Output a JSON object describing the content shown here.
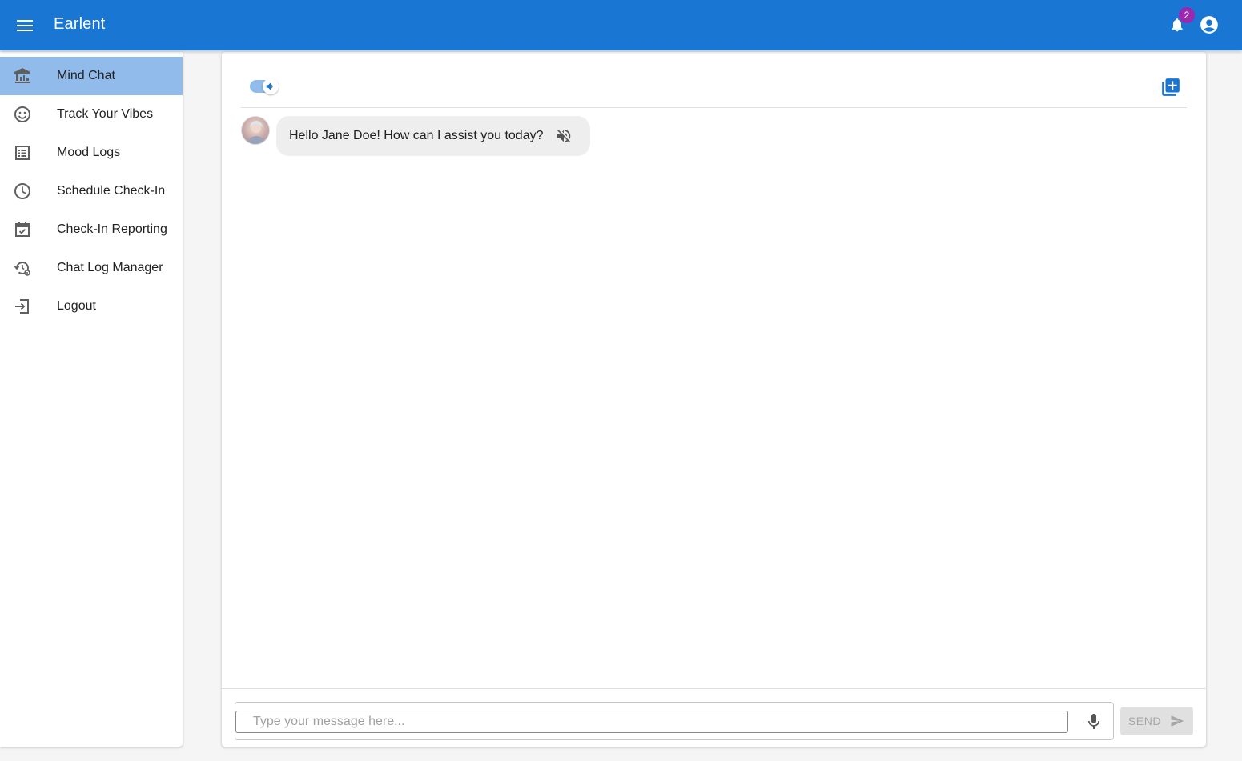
{
  "app": {
    "title": "Earlent",
    "notifications_count": "2",
    "brand_color": "#1976d2",
    "badge_color": "#9c27b0"
  },
  "sidebar": {
    "items": [
      {
        "label": "Mind Chat",
        "icon": "chart-columns-icon",
        "active": true
      },
      {
        "label": "Track Your Vibes",
        "icon": "smiley-icon"
      },
      {
        "label": "Mood Logs",
        "icon": "list-icon"
      },
      {
        "label": "Schedule Check-In",
        "icon": "clock-icon"
      },
      {
        "label": "Check-In Reporting",
        "icon": "calendar-check-icon"
      },
      {
        "label": "Chat Log Manager",
        "icon": "history-settings-icon"
      },
      {
        "label": "Logout",
        "icon": "logout-icon"
      }
    ],
    "active_color": "#90bbea"
  },
  "chat": {
    "messages": [
      {
        "sender": "assistant",
        "text": "Hello Jane Doe! How can I assist you today?"
      }
    ],
    "input": {
      "value": "",
      "placeholder": "Type your message here..."
    },
    "send_label": "SEND",
    "audio_enabled": true
  }
}
